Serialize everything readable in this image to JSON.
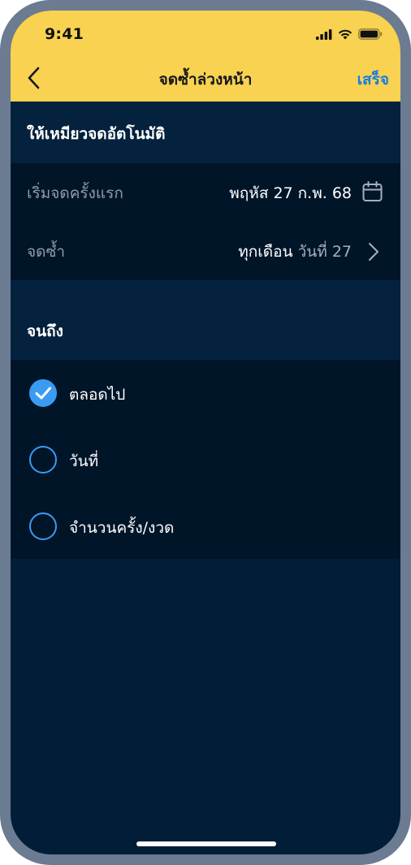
{
  "status_bar": {
    "time": "9:41"
  },
  "nav": {
    "back_icon": "chevron-left-icon",
    "title": "จดซ้ำล่วงหน้า",
    "done_label": "เสร็จ"
  },
  "auto_reminder": {
    "header": "ให้เหมียวจดอัตโนมัติ",
    "start_label": "เริ่มจดครั้งแรก",
    "start_value": "พฤหัส 27 ก.พ. 68",
    "start_icon": "calendar-icon",
    "repeat_label": "จดซ้ำ",
    "repeat_value": "ทุกเดือน",
    "repeat_value_detail": "วันที่ 27",
    "repeat_icon": "chevron-right-icon"
  },
  "until": {
    "header": "จนถึง",
    "options": [
      {
        "label": "ตลอดไป",
        "selected": true
      },
      {
        "label": "วันที่",
        "selected": false
      },
      {
        "label": "จำนวนครั้ง/งวด",
        "selected": false
      }
    ]
  },
  "colors": {
    "header_yellow": "#f8d250",
    "background_navy": "#021d38",
    "panel_navy": "#011529",
    "accent_blue": "#3a9bf2",
    "done_blue": "#1a7ee0"
  }
}
